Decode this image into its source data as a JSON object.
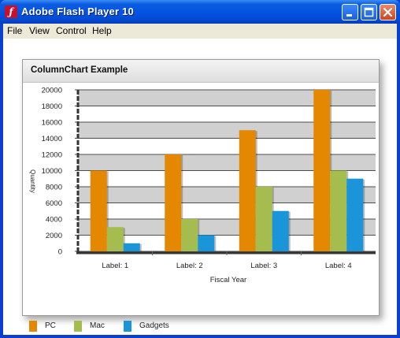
{
  "window": {
    "title": "Adobe Flash Player 10",
    "icon": "flash-player-icon"
  },
  "menu": {
    "items": [
      "File",
      "View",
      "Control",
      "Help"
    ]
  },
  "panel": {
    "title": "ColumnChart Example"
  },
  "colors": {
    "PC": "#e48701",
    "Mac": "#a5bc4e",
    "Gadgets": "#1b95d9"
  },
  "chart_data": {
    "type": "bar",
    "title": "",
    "xlabel": "Fiscal Year",
    "ylabel": "Quantity",
    "categories": [
      "Label: 1",
      "Label: 2",
      "Label: 3",
      "Label: 4"
    ],
    "series": [
      {
        "name": "PC",
        "values": [
          10000,
          12000,
          15000,
          20000
        ]
      },
      {
        "name": "Mac",
        "values": [
          3000,
          4000,
          8000,
          10000
        ]
      },
      {
        "name": "Gadgets",
        "values": [
          1000,
          2000,
          5000,
          9000
        ]
      }
    ],
    "ylim": [
      0,
      20000
    ],
    "yticks": [
      "20000",
      "18000",
      "16000",
      "14000",
      "12000",
      "10000",
      "8000",
      "6000",
      "4000",
      "2000",
      "0"
    ],
    "grid": "alternating bands",
    "legend": "bottom-left"
  }
}
